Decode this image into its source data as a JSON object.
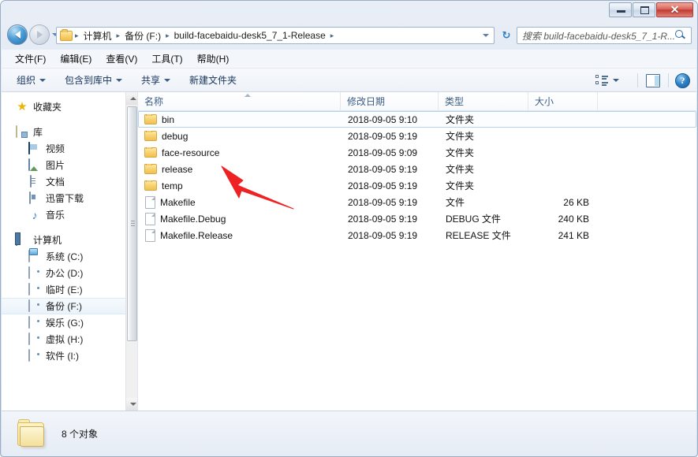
{
  "window": {
    "minimize_label": "—",
    "maximize_label": "□",
    "close_label": "✕"
  },
  "address": {
    "back_icon": "back-arrow-icon",
    "forward_icon": "forward-arrow-icon",
    "history_icon": "chevron-down-icon",
    "folder_icon": "folder-icon",
    "crumbs": [
      "计算机",
      "备份 (F:)",
      "build-facebaidu-desk5_7_1-Release"
    ],
    "separator": "▸",
    "refresh_label": "↻",
    "dropdown_icon": "chevron-down-icon"
  },
  "search": {
    "placeholder": "搜索 build-facebaidu-desk5_7_1-R...",
    "icon": "search-icon"
  },
  "menubar": {
    "items": [
      {
        "label": "文件(F)"
      },
      {
        "label": "编辑(E)"
      },
      {
        "label": "查看(V)"
      },
      {
        "label": "工具(T)"
      },
      {
        "label": "帮助(H)"
      }
    ]
  },
  "toolbar": {
    "organize": "组织",
    "include_in_library": "包含到库中",
    "share": "共享",
    "new_folder": "新建文件夹",
    "view_icon": "view-options-icon",
    "preview_pane_icon": "preview-pane-icon",
    "help_label": "?"
  },
  "sidebar": {
    "favorites": {
      "label": "收藏夹",
      "icon": "star-icon"
    },
    "libraries": {
      "label": "库",
      "icon": "library-icon",
      "children": [
        {
          "label": "视频",
          "icon": "video-icon"
        },
        {
          "label": "图片",
          "icon": "picture-icon"
        },
        {
          "label": "文档",
          "icon": "document-icon"
        },
        {
          "label": "迅雷下载",
          "icon": "download-icon"
        },
        {
          "label": "音乐",
          "icon": "music-icon"
        }
      ]
    },
    "computer": {
      "label": "计算机",
      "icon": "computer-icon",
      "children": [
        {
          "label": "系统 (C:)",
          "icon": "system-drive-icon",
          "selected": false
        },
        {
          "label": "办公 (D:)",
          "icon": "drive-icon",
          "selected": false
        },
        {
          "label": "临时 (E:)",
          "icon": "drive-icon",
          "selected": false
        },
        {
          "label": "备份 (F:)",
          "icon": "drive-icon",
          "selected": true
        },
        {
          "label": "娱乐 (G:)",
          "icon": "drive-icon",
          "selected": false
        },
        {
          "label": "虚拟 (H:)",
          "icon": "drive-icon",
          "selected": false
        },
        {
          "label": "软件 (I:)",
          "icon": "drive-icon",
          "selected": false
        }
      ]
    }
  },
  "filelist": {
    "columns": [
      {
        "label": "名称",
        "sorted": true
      },
      {
        "label": "修改日期",
        "sorted": false
      },
      {
        "label": "类型",
        "sorted": false
      },
      {
        "label": "大小",
        "sorted": false
      }
    ],
    "rows": [
      {
        "name": "bin",
        "date": "2018-09-05 9:10",
        "type": "文件夹",
        "size": "",
        "kind": "folder",
        "focused": true
      },
      {
        "name": "debug",
        "date": "2018-09-05 9:19",
        "type": "文件夹",
        "size": "",
        "kind": "folder",
        "focused": false
      },
      {
        "name": "face-resource",
        "date": "2018-09-05 9:09",
        "type": "文件夹",
        "size": "",
        "kind": "folder",
        "focused": false
      },
      {
        "name": "release",
        "date": "2018-09-05 9:19",
        "type": "文件夹",
        "size": "",
        "kind": "folder",
        "focused": false
      },
      {
        "name": "temp",
        "date": "2018-09-05 9:19",
        "type": "文件夹",
        "size": "",
        "kind": "folder",
        "focused": false
      },
      {
        "name": "Makefile",
        "date": "2018-09-05 9:19",
        "type": "文件",
        "size": "26 KB",
        "kind": "file",
        "focused": false
      },
      {
        "name": "Makefile.Debug",
        "date": "2018-09-05 9:19",
        "type": "DEBUG 文件",
        "size": "240 KB",
        "kind": "file",
        "focused": false
      },
      {
        "name": "Makefile.Release",
        "date": "2018-09-05 9:19",
        "type": "RELEASE 文件",
        "size": "241 KB",
        "kind": "file",
        "focused": false
      }
    ]
  },
  "annotation": {
    "type": "arrow",
    "color": "#ee2222",
    "points_at": "face-resource"
  },
  "statusbar": {
    "item_count_label": "8 个对象",
    "folder_icon": "folder-icon"
  }
}
